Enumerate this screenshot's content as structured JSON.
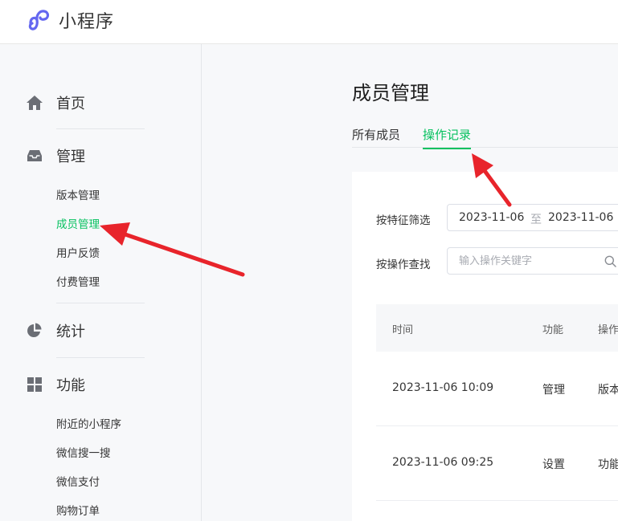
{
  "app": {
    "title": "小程序",
    "brand_color": "#6467f0"
  },
  "sidebar": {
    "home": {
      "label": "首页",
      "icon": "home-icon"
    },
    "manage": {
      "label": "管理",
      "icon": "inbox-icon",
      "items": [
        "版本管理",
        "成员管理",
        "用户反馈",
        "付费管理"
      ],
      "active_index": 1
    },
    "stats": {
      "label": "统计",
      "icon": "pie-chart-icon"
    },
    "features": {
      "label": "功能",
      "icon": "grid-icon",
      "items": [
        "附近的小程序",
        "微信搜一搜",
        "微信支付",
        "购物订单"
      ]
    }
  },
  "main": {
    "title": "成员管理",
    "tabs": [
      {
        "label": "所有成员",
        "active": false
      },
      {
        "label": "操作记录",
        "active": true
      }
    ],
    "accent_color": "#07c160",
    "filter": {
      "feature_label": "按特征筛选",
      "date_from": "2023-11-06",
      "date_sep": "至",
      "date_to": "2023-11-06",
      "search_label": "按操作查找",
      "search_placeholder": "输入操作关键字",
      "search_value": ""
    },
    "table": {
      "columns": [
        "时间",
        "功能",
        "操作"
      ],
      "rows": [
        {
          "time": "2023-11-06 10:09",
          "feature": "管理",
          "action": "版本"
        },
        {
          "time": "2023-11-06 09:25",
          "feature": "设置",
          "action": "功能"
        }
      ]
    }
  },
  "annotation_color": "#e8242b"
}
